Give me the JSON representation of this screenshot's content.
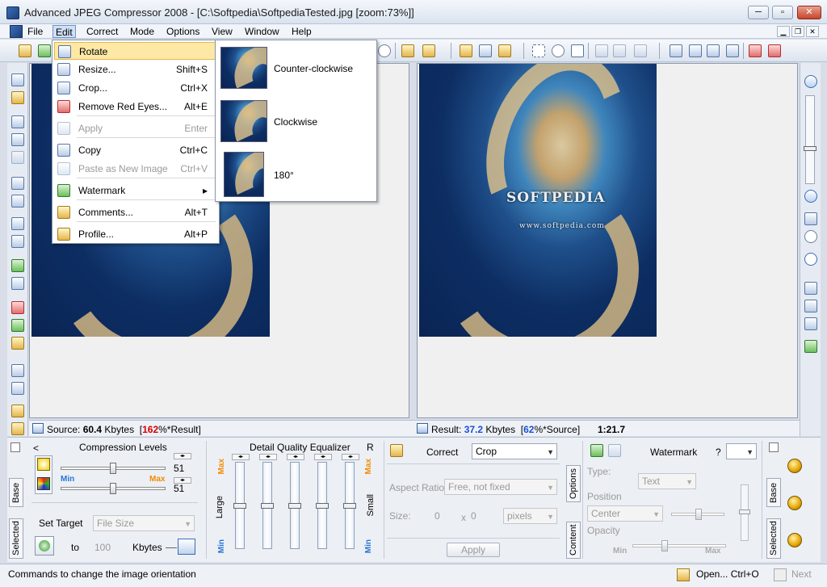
{
  "window": {
    "title": "Advanced JPEG Compressor 2008 - [C:\\Softpedia\\SoftpediaTested.jpg  [zoom:73%]]",
    "minimize": "─",
    "maximize": "▫",
    "close": "✕"
  },
  "menubar": {
    "items": [
      "File",
      "Edit",
      "Correct",
      "Mode",
      "Options",
      "View",
      "Window",
      "Help"
    ],
    "active": "Edit",
    "mdi_min": "▁",
    "mdi_restore": "❐",
    "mdi_close": "✕"
  },
  "edit_menu": {
    "items": [
      {
        "label": "Rotate",
        "shortcut": "",
        "icon": "rotate-icon",
        "disabled": false,
        "highlight": true,
        "submenu": false
      },
      {
        "label": "Resize...",
        "shortcut": "Shift+S",
        "icon": "resize-icon",
        "disabled": false
      },
      {
        "label": "Crop...",
        "shortcut": "Ctrl+X",
        "icon": "crop-icon",
        "disabled": false
      },
      {
        "label": "Remove Red Eyes...",
        "shortcut": "Alt+E",
        "icon": "red-eye-icon",
        "disabled": false
      },
      {
        "label": "Apply",
        "shortcut": "Enter",
        "icon": "apply-icon",
        "disabled": true
      },
      {
        "label": "Copy",
        "shortcut": "Ctrl+C",
        "icon": "copy-icon",
        "disabled": false
      },
      {
        "label": "Paste as New Image",
        "shortcut": "Ctrl+V",
        "icon": "paste-icon",
        "disabled": true
      },
      {
        "label": "Watermark",
        "shortcut": "▸",
        "icon": "watermark-icon",
        "disabled": false
      },
      {
        "label": "Comments...",
        "shortcut": "Alt+T",
        "icon": "comments-icon",
        "disabled": false
      },
      {
        "label": "Profile...",
        "shortcut": "Alt+P",
        "icon": "profile-icon",
        "disabled": false
      }
    ]
  },
  "rotate_submenu": {
    "items": [
      "Counter-clockwise",
      "Clockwise",
      "180°"
    ]
  },
  "watermark_text": {
    "brand": "SOFTPEDIA",
    "url": "www.softpedia.com"
  },
  "status": {
    "source_label": "Source:",
    "source_value": "60.4",
    "source_unit": "Kbytes",
    "source_pct": "162",
    "source_suffix": "%*Result]",
    "source_prefix": "[",
    "result_label": "Result:",
    "result_value": "37.2",
    "result_unit": "Kbytes",
    "result_pct": "62",
    "result_suffix": "%*Source]",
    "result_prefix": "[",
    "ratio": "1:21.7"
  },
  "compression": {
    "title": "Compression Levels",
    "back": "<",
    "value1": "51",
    "value2": "51",
    "min": "Min",
    "max": "Max",
    "set_target": "Set Target",
    "target_mode": "File Size",
    "to": "to",
    "target_value": "100",
    "unit": "Kbytes",
    "tab_base": "Base",
    "tab_selected": "Selected"
  },
  "equalizer": {
    "title": "Detail Quality Equalizer",
    "r": "R",
    "large": "Large",
    "small": "Small",
    "max": "Max",
    "min": "Min",
    "levels": [
      0.5,
      0.5,
      0.5,
      0.5,
      0.5
    ]
  },
  "correct": {
    "label": "Correct",
    "mode": "Crop",
    "aspect_label": "Aspect Ratio:",
    "aspect_value": "Free, not fixed",
    "size_label": "Size:",
    "w": "0",
    "x": "x",
    "h": "0",
    "unit": "pixels",
    "apply": "Apply",
    "tab_options": "Options",
    "tab_content": "Content"
  },
  "watermark": {
    "title": "Watermark",
    "help": "?",
    "type_label": "Type:",
    "type_value": "Text",
    "position_label": "Position",
    "position_value": "Center",
    "opacity_label": "Opacity",
    "min": "Min",
    "max": "Max",
    "tab_base": "Base",
    "tab_selected": "Selected"
  },
  "statusbar": {
    "message": "Commands to change the image orientation",
    "open": "Open...",
    "open_shortcut": "Ctrl+O",
    "next": "Next"
  }
}
